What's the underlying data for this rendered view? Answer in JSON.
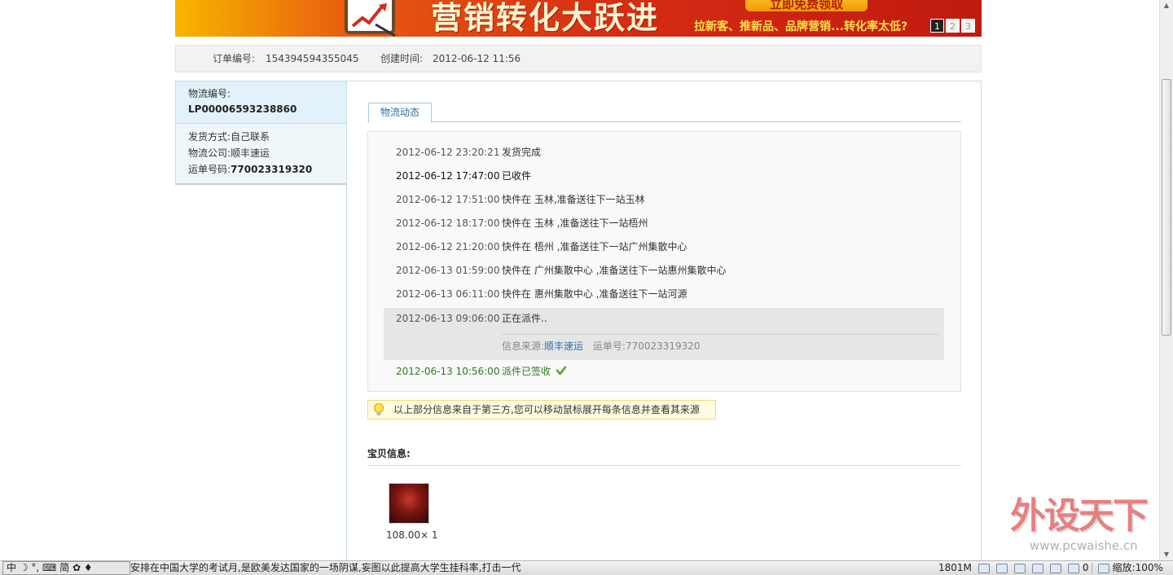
{
  "banner": {
    "title": "营销转化大跃进",
    "button": "立即免费领取",
    "subtitle": "拉新客、推新品、品牌营销...转化率太低?",
    "pages": [
      "1",
      "2",
      "3"
    ],
    "active_page": "1"
  },
  "order": {
    "number_label": "订单编号:",
    "number": "154394594355045",
    "created_label": "创建时间:",
    "created": "2012-06-12 11:56"
  },
  "logistics": {
    "no_label": "物流编号:",
    "no": "LP00006593238860",
    "method_label": "发货方式:",
    "method": "自己联系",
    "company_label": "物流公司:",
    "company": "顺丰速运",
    "waybill_label": "运单号码:",
    "waybill": "770023319320"
  },
  "tab": {
    "label": "物流动态"
  },
  "events": [
    {
      "time": "2012-06-12 23:20:21",
      "desc": "发货完成"
    },
    {
      "time": "2012-06-12 17:47:00",
      "desc": "已收件"
    },
    {
      "time": "2012-06-12 17:51:00",
      "desc": "快件在 玉林,准备送往下一站玉林"
    },
    {
      "time": "2012-06-12 18:17:00",
      "desc": "快件在 玉林 ,准备送往下一站梧州"
    },
    {
      "time": "2012-06-12 21:20:00",
      "desc": "快件在 梧州 ,准备送往下一站广州集散中心"
    },
    {
      "time": "2012-06-13 01:59:00",
      "desc": "快件在 广州集散中心 ,准备送往下一站惠州集散中心"
    },
    {
      "time": "2012-06-13 06:11:00",
      "desc": "快件在 惠州集散中心 ,准备送往下一站河源"
    },
    {
      "time": "2012-06-13 09:06:00",
      "desc": "正在派件.."
    },
    {
      "time": "2012-06-13 10:56:00",
      "desc": "派件已签收"
    }
  ],
  "source": {
    "label": "信息来源:",
    "name": "顺丰速运",
    "waybill_label": "运单号:",
    "waybill": "770023319320"
  },
  "tip": "以上部分信息来自于第三方,您可以移动鼠标展开每条信息并查看其来源",
  "goods": {
    "title": "宝贝信息:",
    "price": "108.00× 1"
  },
  "watermark": {
    "title": "外设天下",
    "url": "www.pcwaishe.cn"
  },
  "statusbar": {
    "ime": "中 ☽ °, ⌨ 简 ✿ ♦",
    "ticker": "安排在中国大学的考试月,是欧美发达国家的一场阴谋,妄图以此提高大学生挂科率,打击一代",
    "memory": "1801M",
    "count": "0",
    "zoom": "缩放:100%"
  },
  "colors": {
    "link": "#2b6fb0",
    "done": "#2c7a1e",
    "tab": "#2c6f9f"
  }
}
